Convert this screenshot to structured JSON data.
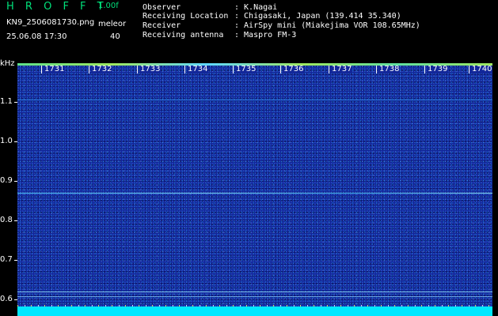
{
  "header": {
    "app_title": "H R O F F T",
    "version": "1.00f",
    "file_name": "KN9_2506081730.png",
    "mode": "meleor",
    "datetime": "25.06.08 17:30",
    "number": "40",
    "info": [
      {
        "label": "Observer",
        "value": ": K.Nagai"
      },
      {
        "label": "Receiving Location",
        "value": ": Chigasaki, Japan (139.414 35.340)"
      },
      {
        "label": "Receiver",
        "value": ": AirSpy mini (Miakejima VOR 108.65MHz)"
      },
      {
        "label": "Receiving antenna",
        "value": ": Maspro FM-3"
      }
    ]
  },
  "spectrogram": {
    "unit": "kHz",
    "y_ticks": [
      "1.1",
      "1.0",
      "0.9",
      "0.8",
      "0.7",
      "0.6"
    ],
    "time_labels": [
      "1731",
      "1732",
      "1733",
      "1734",
      "1735",
      "1736",
      "1737",
      "1738",
      "1739",
      "1740"
    ],
    "colors": {
      "background": "#12279a",
      "signal": "#4fc8ff",
      "noise_floor": "#00e8ff"
    }
  }
}
